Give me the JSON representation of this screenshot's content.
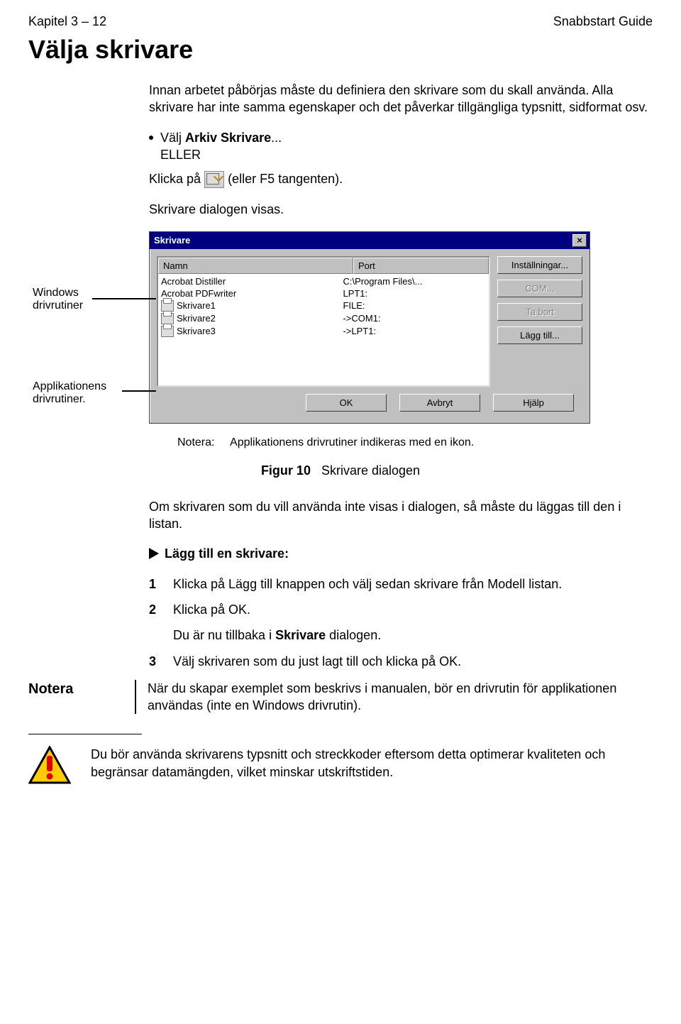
{
  "header": {
    "left": "Kapitel 3 – 12",
    "right": "Snabbstart Guide"
  },
  "title": "Välja skrivare",
  "intro": {
    "p1": "Innan arbetet påbörjas måste du definiera den skrivare som du skall använda. Alla skrivare har inte samma egenskaper och det påverkar tillgängliga typsnitt, sidformat osv.",
    "bullet_pre": "Välj ",
    "bullet_bold": "Arkiv Skrivare",
    "bullet_post": "...",
    "eller": "ELLER",
    "klicka_pre": "Klicka på ",
    "klicka_post": " (eller F5 tangenten).",
    "dialog_visas": "Skrivare dialogen visas."
  },
  "callouts": {
    "windows": "Windows\ndrivrutiner",
    "app": "Applikationens\ndrivrutiner."
  },
  "dialog": {
    "title": "Skrivare",
    "close": "×",
    "col_name": "Namn",
    "col_port": "Port",
    "rows": [
      {
        "name": "Acrobat Distiller",
        "port": "C:\\Program Files\\...",
        "icon": false
      },
      {
        "name": "Acrobat PDFwriter",
        "port": "LPT1:",
        "icon": false
      },
      {
        "name": "Skrivare1",
        "port": "FILE:",
        "icon": true
      },
      {
        "name": "Skrivare2",
        "port": "->COM1:",
        "icon": true
      },
      {
        "name": "Skrivare3",
        "port": "->LPT1:",
        "icon": true
      }
    ],
    "right": {
      "settings": "Inställningar...",
      "com": "COM...",
      "tabort": "Ta bort",
      "lagg": "Lägg till..."
    },
    "foot": {
      "ok": "OK",
      "avbryt": "Avbryt",
      "hjalp": "Hjälp"
    }
  },
  "note_inline": {
    "label": "Notera:",
    "text": "Applikationens drivrutiner indikeras med en ikon."
  },
  "figure": {
    "num": "Figur 10",
    "caption": "Skrivare dialogen"
  },
  "after": "Om skrivaren som du vill använda inte visas i dialogen, så måste du läggas till den i listan.",
  "add_title": "Lägg till en skrivare:",
  "steps": [
    {
      "n": "1",
      "t": "Klicka på Lägg till knappen och välj sedan skrivare från Modell listan."
    },
    {
      "n": "2",
      "t": "Klicka på OK."
    },
    {
      "n": "",
      "t_pre": "Du är nu tillbaka i ",
      "t_bold": "Skrivare",
      "t_post": " dialogen."
    },
    {
      "n": "3",
      "t": "Välj skrivaren som du just lagt till och klicka på OK."
    }
  ],
  "side_note": {
    "tag": "Notera",
    "text": "När du skapar exemplet som beskrivs i manualen, bör en drivrutin för applikationen användas (inte en Windows drivrutin)."
  },
  "warning": "Du bör använda skrivarens typsnitt och streckkoder eftersom detta optimerar kvaliteten och begränsar datamängden, vilket minskar utskriftstiden."
}
